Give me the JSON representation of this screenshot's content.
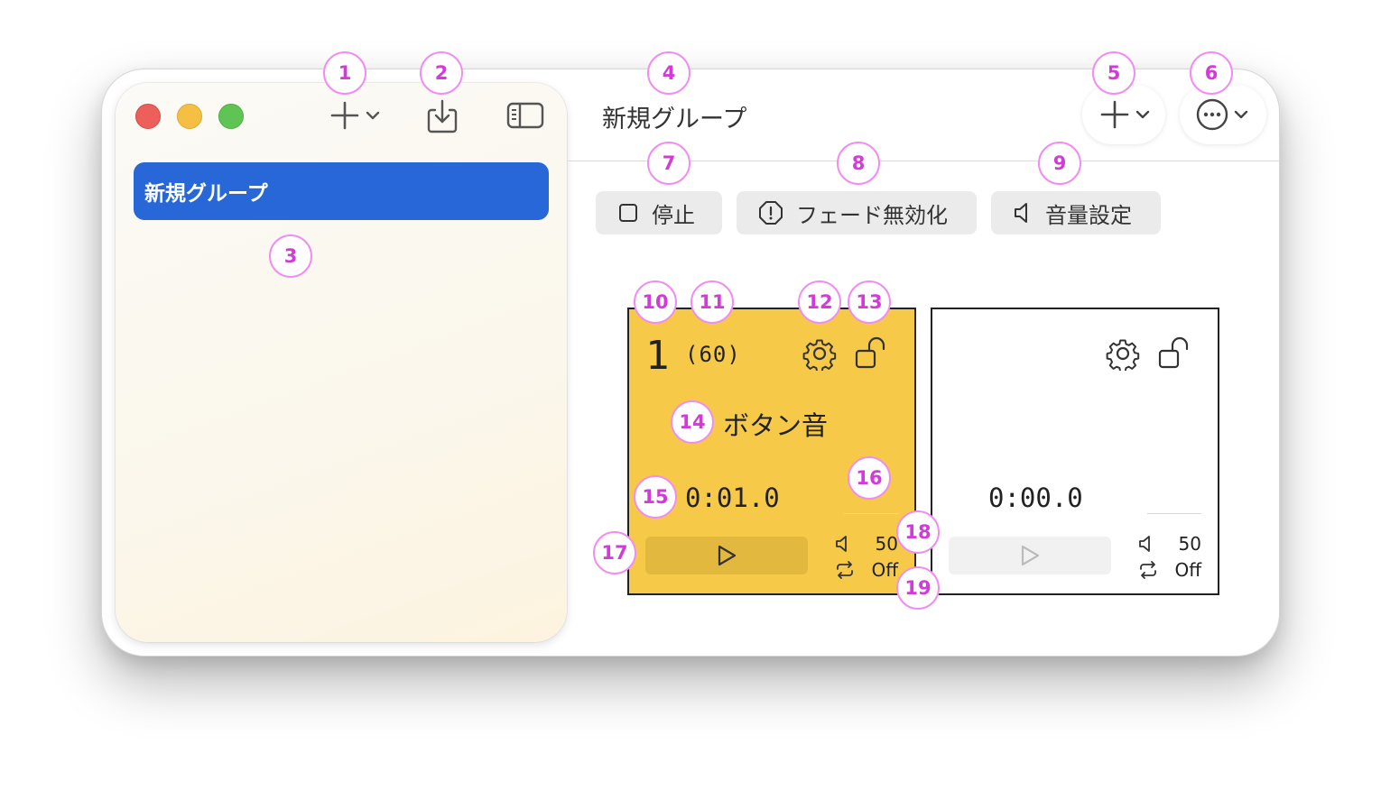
{
  "sidebar": {
    "selected_group": "新規グループ"
  },
  "header": {
    "title": "新規グループ"
  },
  "toolbar": {
    "stop_label": "停止",
    "fade_disable_label": "フェード無効化",
    "volume_settings_label": "音量設定"
  },
  "cards": [
    {
      "number": "1",
      "count": "(60)",
      "name": "ボタン音",
      "time": "0:01.0",
      "volume": "50",
      "loop": "Off",
      "color": "#f7c948"
    },
    {
      "number": "",
      "count": "",
      "name": "",
      "time": "0:00.0",
      "volume": "50",
      "loop": "Off",
      "color": "#ffffff"
    }
  ],
  "annotations": [
    "1",
    "2",
    "3",
    "4",
    "5",
    "6",
    "7",
    "8",
    "9",
    "10",
    "11",
    "12",
    "13",
    "14",
    "15",
    "16",
    "17",
    "18",
    "19"
  ],
  "colors": {
    "accent": "#2767d8",
    "card_active": "#f7c948",
    "badge": "#d23bd8",
    "traffic_close": "#ec5f5a",
    "traffic_min": "#f4bf42",
    "traffic_max": "#5fc453"
  }
}
